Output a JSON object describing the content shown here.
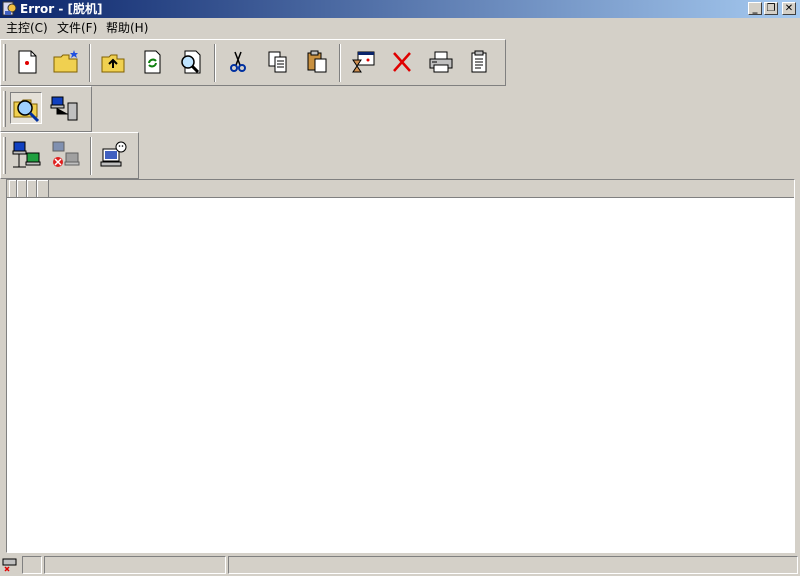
{
  "window": {
    "title": "Error - [脱机]",
    "minimize_glyph": "_",
    "restore_glyph": "❐",
    "close_glyph": "✕"
  },
  "menu": [
    "主控(C)",
    "文件(F)",
    "帮助(H)"
  ],
  "toolbar_main": {
    "icons": [
      "new-document-icon",
      "new-folder-icon",
      "up-folder-icon",
      "refresh-icon",
      "find-icon",
      "cut-icon",
      "copy-icon",
      "paste-icon",
      "schedule-icon",
      "delete-icon",
      "print-icon",
      "properties-icon"
    ]
  },
  "toolbar_view": {
    "icons": [
      "search-folder-icon",
      "network-server-icon"
    ]
  },
  "toolbar_connect": {
    "icons": [
      "connect-computer-icon",
      "disconnect-computer-icon",
      "remote-user-icon"
    ]
  },
  "list": {
    "column_count": 4
  },
  "statusbar": {
    "icons": [
      "offline-status-icon"
    ],
    "texts": [
      "",
      "",
      ""
    ]
  }
}
